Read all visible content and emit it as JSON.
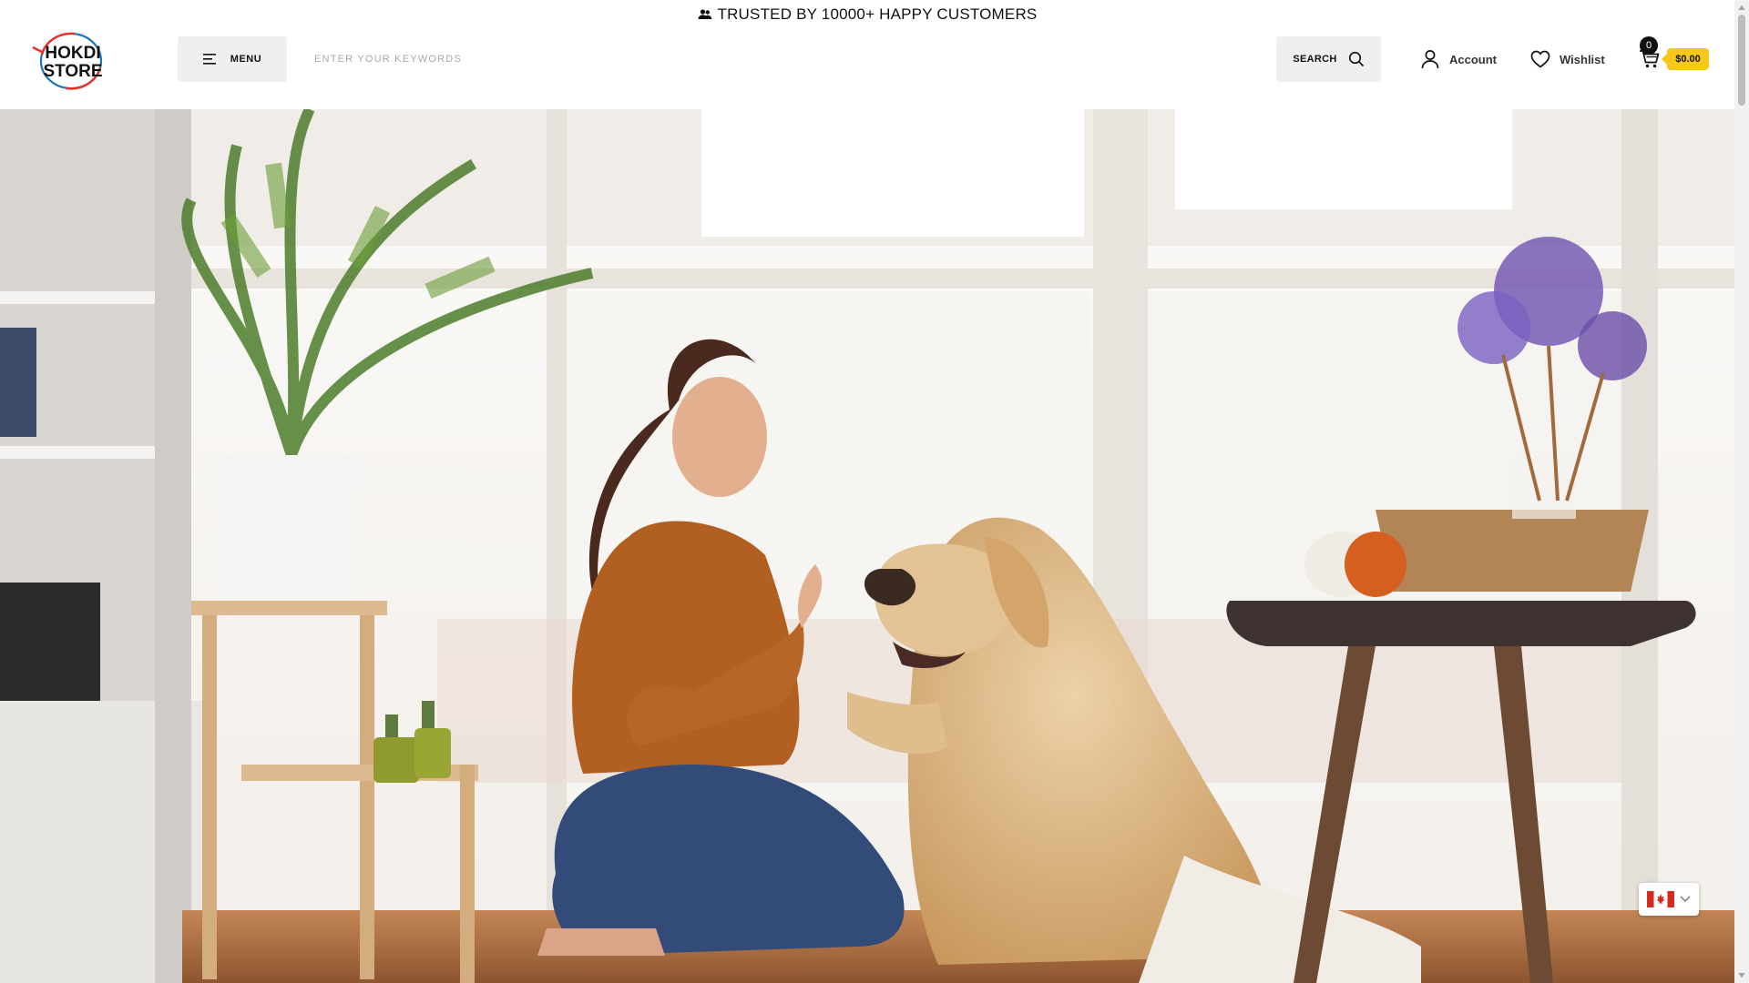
{
  "announcement": {
    "text": "TRUSTED BY 10000+ HAPPY CUSTOMERS",
    "icon": "users-icon"
  },
  "logo": {
    "line1": "HOKDI",
    "line2": "STORE"
  },
  "header": {
    "menu_label": "MENU",
    "search_placeholder": "ENTER YOUR KEYWORDS",
    "search_label": "SEARCH",
    "account_label": "Account",
    "wishlist_label": "Wishlist",
    "cart_count": "0",
    "cart_total": "$0.00"
  },
  "currency": {
    "country": "Canada",
    "icon": "canada-flag-icon"
  },
  "colors": {
    "accent": "#f6c81c",
    "button_bg": "#efefef"
  }
}
